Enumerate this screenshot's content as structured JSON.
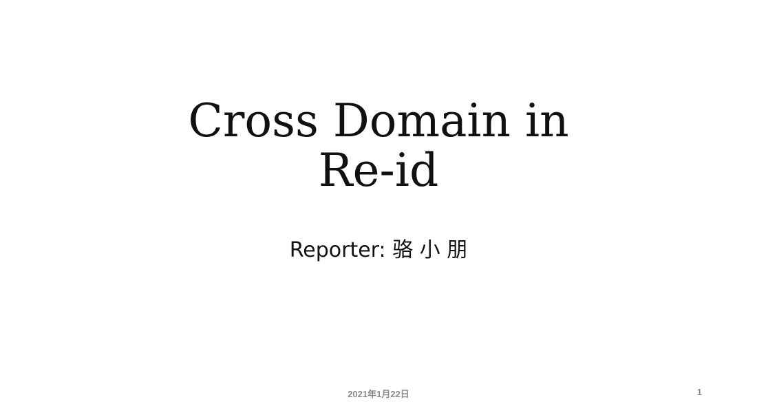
{
  "slide": {
    "title_line1": "Cross Domain in",
    "title_line2": "Re-id",
    "subtitle": "Reporter: 骆 小 朋",
    "date": "2021年1月22日",
    "page_number": "1"
  }
}
